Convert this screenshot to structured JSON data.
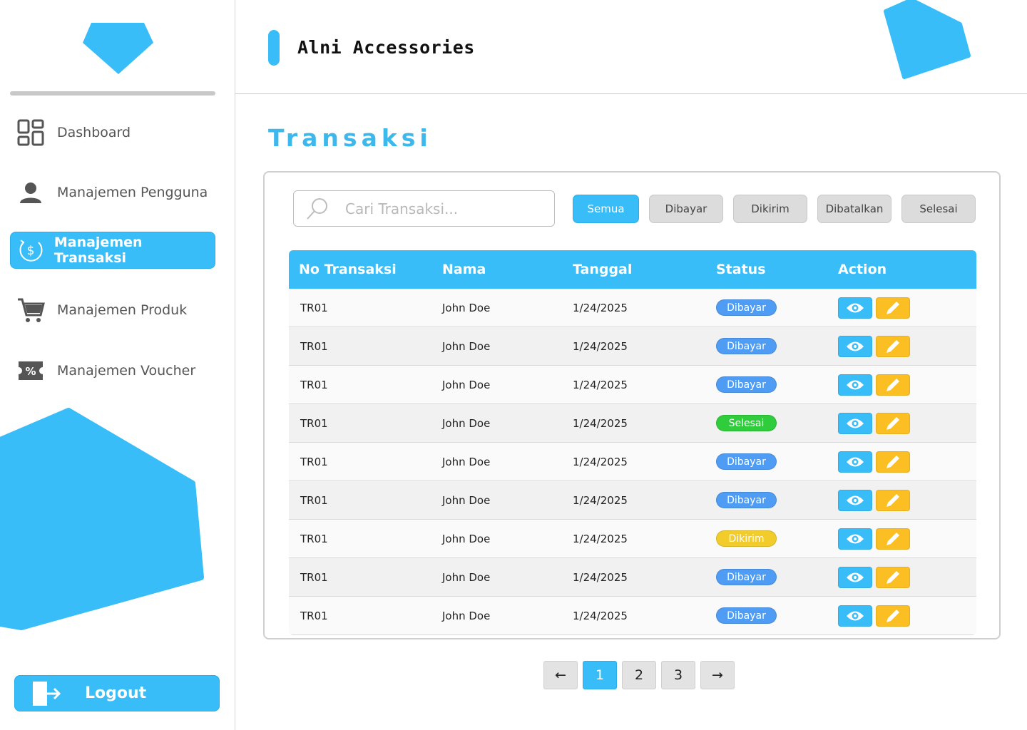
{
  "colors": {
    "accent": "#38bdf8",
    "dibayar": "#4f9cf4",
    "selesai": "#2fcc3b",
    "dikirim": "#f2cc2a",
    "edit": "#fbbf24"
  },
  "app": {
    "title": "Alni Accessories"
  },
  "sidebar": {
    "items": [
      {
        "label": "Dashboard",
        "icon": "dashboard-grid-icon"
      },
      {
        "label": "Manajemen Pengguna",
        "icon": "user-icon"
      },
      {
        "label": "Manajemen Transaksi",
        "icon": "dollar-cycle-icon",
        "active": true
      },
      {
        "label": "Manajemen Produk",
        "icon": "cart-icon"
      },
      {
        "label": "Manajemen Voucher",
        "icon": "voucher-percent-icon"
      }
    ],
    "logout_label": "Logout"
  },
  "main": {
    "title": "Transaksi",
    "search": {
      "placeholder": "Cari Transaksi...",
      "value": ""
    },
    "filters": [
      "Semua",
      "Dibayar",
      "Dikirim",
      "Dibatalkan",
      "Selesai"
    ],
    "active_filter": "Semua",
    "table": {
      "headers": [
        "No Transaksi",
        "Nama",
        "Tanggal",
        "Status",
        "Action"
      ],
      "rows": [
        {
          "id": "TR01",
          "name": "John Doe",
          "date": "1/24/2025",
          "status": "Dibayar"
        },
        {
          "id": "TR01",
          "name": "John Doe",
          "date": "1/24/2025",
          "status": "Dibayar"
        },
        {
          "id": "TR01",
          "name": "John Doe",
          "date": "1/24/2025",
          "status": "Dibayar"
        },
        {
          "id": "TR01",
          "name": "John Doe",
          "date": "1/24/2025",
          "status": "Selesai"
        },
        {
          "id": "TR01",
          "name": "John Doe",
          "date": "1/24/2025",
          "status": "Dibayar"
        },
        {
          "id": "TR01",
          "name": "John Doe",
          "date": "1/24/2025",
          "status": "Dibayar"
        },
        {
          "id": "TR01",
          "name": "John Doe",
          "date": "1/24/2025",
          "status": "Dikirim"
        },
        {
          "id": "TR01",
          "name": "John Doe",
          "date": "1/24/2025",
          "status": "Dibayar"
        },
        {
          "id": "TR01",
          "name": "John Doe",
          "date": "1/24/2025",
          "status": "Dibayar"
        }
      ]
    },
    "pagination": {
      "prev": "←",
      "pages": [
        "1",
        "2",
        "3"
      ],
      "current": "1",
      "next": "→"
    }
  }
}
